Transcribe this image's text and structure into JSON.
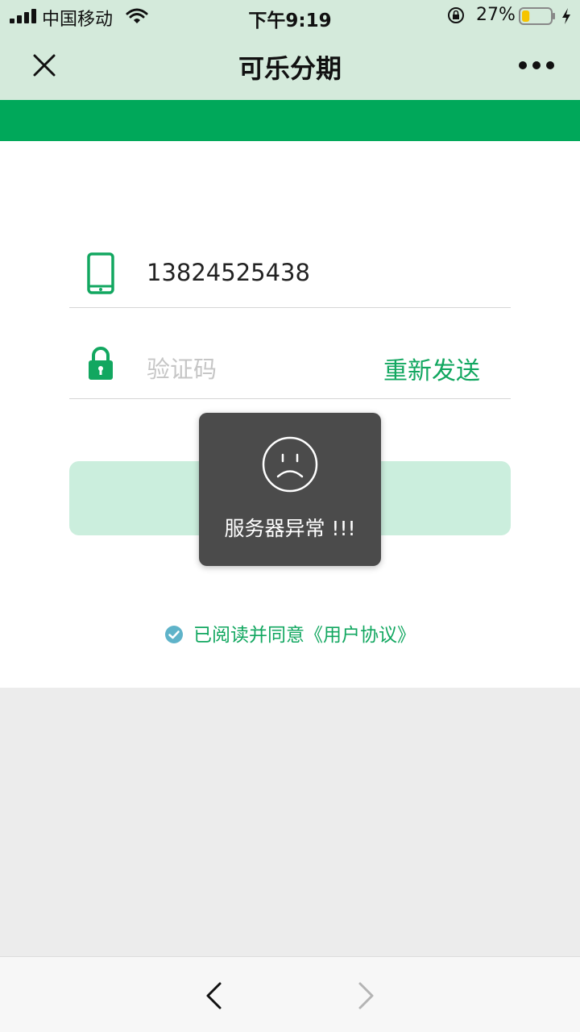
{
  "status_bar": {
    "carrier": "中国移动",
    "time": "下午9:19",
    "battery_percent": "27%",
    "battery_level": 0.27,
    "icons": [
      "signal-icon",
      "wifi-icon",
      "rotation-lock-icon",
      "battery-icon",
      "charging-icon"
    ]
  },
  "nav": {
    "title": "可乐分期",
    "close_icon": "close-icon",
    "more_icon": "more-icon"
  },
  "form": {
    "phone_value": "13824525438",
    "code_placeholder": "验证码",
    "resend_label": "重新发送",
    "agreement": "已阅读并同意《用户协议》"
  },
  "toast": {
    "message": "服务器异常 !!!",
    "icon": "sad-face-icon"
  },
  "colors": {
    "accent": "#00a85a",
    "header_bg": "#d4eadb",
    "button_disabled": "#cbeedd",
    "toast_bg": "#4b4b4b",
    "check": "#5fb3c9"
  }
}
